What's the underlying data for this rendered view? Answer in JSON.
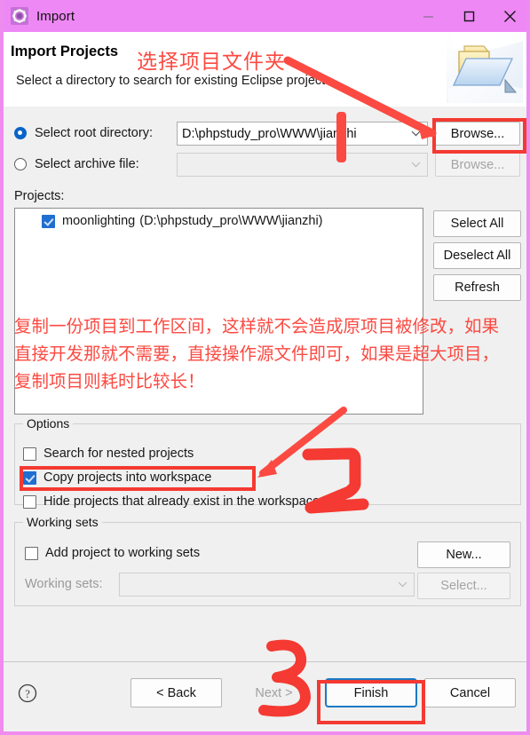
{
  "window": {
    "title": "Import",
    "icon": "import-gear-icon",
    "titlebar_color": "#ee88f5",
    "controls": {
      "minimize": "minimize-icon",
      "maximize": "maximize-icon",
      "close": "close-icon"
    }
  },
  "header": {
    "title": "Import Projects",
    "subtitle": "Select a directory to search for existing Eclipse projects.",
    "image": "open-folder-icon"
  },
  "source": {
    "root_directory": {
      "label": "Select root directory:",
      "selected": true,
      "value": "D:\\phpstudy_pro\\WWW\\jianzhi",
      "browse_label": "Browse..."
    },
    "archive_file": {
      "label": "Select archive file:",
      "selected": false,
      "value": "",
      "browse_label": "Browse..."
    }
  },
  "projects": {
    "label": "Projects:",
    "items": [
      {
        "checked": true,
        "name": "moonlighting",
        "path": "(D:\\phpstudy_pro\\WWW\\jianzhi)"
      }
    ],
    "buttons": {
      "select_all": "Select All",
      "deselect_all": "Deselect All",
      "refresh": "Refresh"
    }
  },
  "options": {
    "title": "Options",
    "items": [
      {
        "label": "Search for nested projects",
        "checked": false
      },
      {
        "label": "Copy projects into workspace",
        "checked": true
      },
      {
        "label": "Hide projects that already exist in the workspace",
        "checked": false
      }
    ]
  },
  "working_sets": {
    "title": "Working sets",
    "add_label": "Add project to working sets",
    "add_checked": false,
    "sets_label": "Working sets:",
    "sets_value": "",
    "new_label": "New...",
    "select_label": "Select..."
  },
  "footer": {
    "help": "help-icon",
    "back": "< Back",
    "next": "Next >",
    "finish": "Finish",
    "cancel": "Cancel"
  },
  "annotations": {
    "accent_color": "#fb4a42",
    "title_note": "选择项目文件夹",
    "body_note": "复制一份项目到工作区间，这样就不会造成原项目被修改，如果直接开发那就不需要，直接操作源文件即可，如果是超大项目，复制项目则耗时比较长！",
    "step_one": "1",
    "step_two": "2",
    "step_three": "3"
  }
}
